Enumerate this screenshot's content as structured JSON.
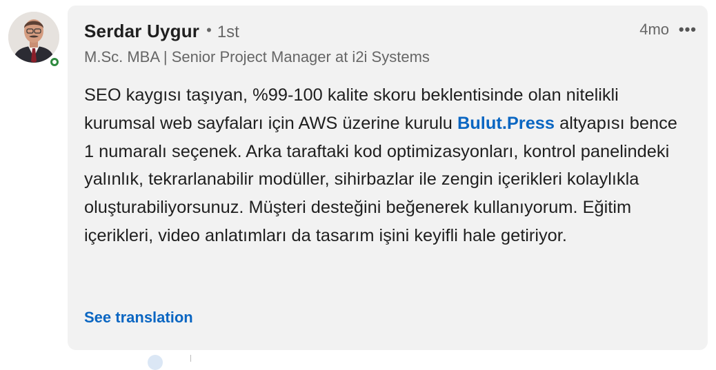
{
  "comment": {
    "author": {
      "name": "Serdar Uygur",
      "separator": "•",
      "degree": "1st",
      "headline": "M.Sc. MBA | Senior Project Manager at i2i Systems",
      "online": true
    },
    "time": "4mo",
    "more_icon": "•••",
    "text_parts": {
      "before_mention": "SEO kaygısı taşıyan, %99-100 kalite skoru beklentisinde olan nitelikli kurumsal web sayfaları için AWS üzerine kurulu ",
      "mention": "Bulut.Press",
      "after_mention": " altyapısı bence 1 numaralı seçenek. Arka taraftaki kod optimizasyonları, kontrol panelindeki yalınlık, tekrarlanabilir modüller, sihirbazlar ile zengin içerikleri kolaylıkla oluşturabiliyorsunuz. Müşteri desteğini beğenerek kullanıyorum. Eğitim içerikleri, video anlatımları da tasarım işini keyifli hale getiriyor."
    },
    "see_translation": "See translation"
  },
  "colors": {
    "bubble_bg": "#f2f2f2",
    "link": "#0a66c2",
    "online": "#2f8a3f",
    "text": "#1f1f1f",
    "muted": "#666666"
  }
}
